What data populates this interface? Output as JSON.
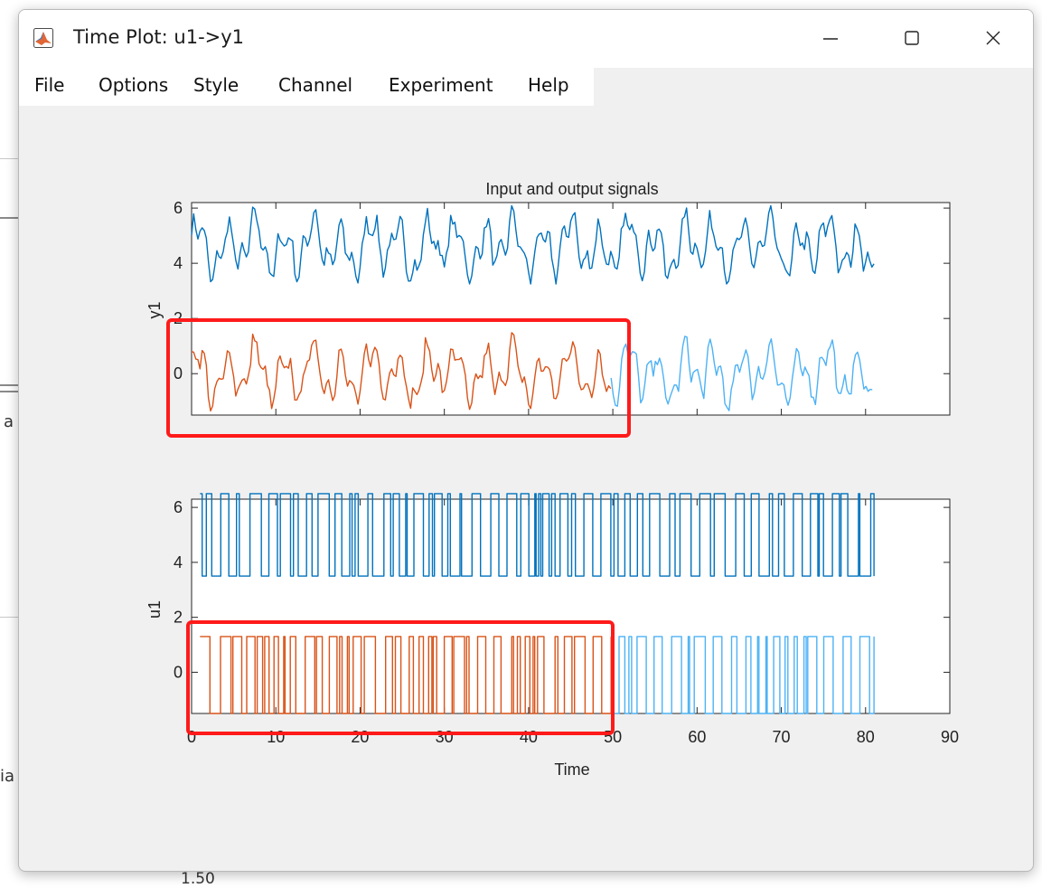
{
  "window": {
    "title": "Time Plot: u1->y1",
    "menu": [
      "File",
      "Options",
      "Style",
      "Channel",
      "Experiment",
      "Help"
    ]
  },
  "background_app": {
    "fragments": [
      "a",
      "ia",
      "1.50"
    ]
  },
  "figure": {
    "title": "Input and output signals",
    "xlabel": "Time",
    "colors": {
      "upper_trace": "#0072bd",
      "estimation_segment": "#d95319",
      "validation_segment": "#4db2f5",
      "highlight_box": "#ff1a1a"
    },
    "highlight_boxes": "two red rectangles around the 0–50 s portion of the lower traces"
  },
  "chart_data": [
    {
      "type": "line",
      "title": "Input and output signals",
      "ylabel": "y1",
      "xlim": [
        0,
        90
      ],
      "ylim": [
        -1.5,
        6.2
      ],
      "yticks": [
        0,
        2,
        4,
        6
      ],
      "ytick_labels": [
        "0",
        "2",
        "4",
        "6"
      ],
      "xticks": [
        0,
        10,
        20,
        30,
        40,
        50,
        60,
        70,
        80,
        90
      ],
      "grid": false,
      "series": [
        {
          "x_range": [
            0,
            81
          ],
          "baseline": 4.6,
          "amplitude": 1.35,
          "color": "#0072bd",
          "style": "smooth"
        },
        {
          "x_range": [
            0,
            49.8
          ],
          "baseline": 0,
          "amplitude": 1.35,
          "color": "#d95319",
          "style": "smooth"
        },
        {
          "x_range": [
            49.8,
            81
          ],
          "baseline": 0,
          "amplitude": 1.35,
          "color": "#4db2f5",
          "style": "smooth"
        }
      ]
    },
    {
      "type": "line",
      "title": "",
      "ylabel": "u1",
      "xlabel": "Time",
      "xlim": [
        0,
        90
      ],
      "ylim": [
        -1.5,
        6.3
      ],
      "yticks": [
        0,
        2,
        4,
        6
      ],
      "ytick_labels": [
        "0",
        "2",
        "4",
        "6"
      ],
      "xticks": [
        0,
        10,
        20,
        30,
        40,
        50,
        60,
        70,
        80,
        90
      ],
      "xtick_labels": [
        "0",
        "10",
        "20",
        "30",
        "40",
        "50",
        "60",
        "70",
        "80",
        "90"
      ],
      "grid": false,
      "series": [
        {
          "x_range": [
            1,
            81
          ],
          "levels": [
            3.5,
            6.5
          ],
          "color": "#0072bd",
          "style": "binary"
        },
        {
          "x_range": [
            1,
            49.8
          ],
          "levels": [
            -1.5,
            1.3
          ],
          "color": "#d95319",
          "style": "binary"
        },
        {
          "x_range": [
            49.8,
            81
          ],
          "levels": [
            -1.5,
            1.3
          ],
          "color": "#4db2f5",
          "style": "binary"
        }
      ]
    }
  ]
}
